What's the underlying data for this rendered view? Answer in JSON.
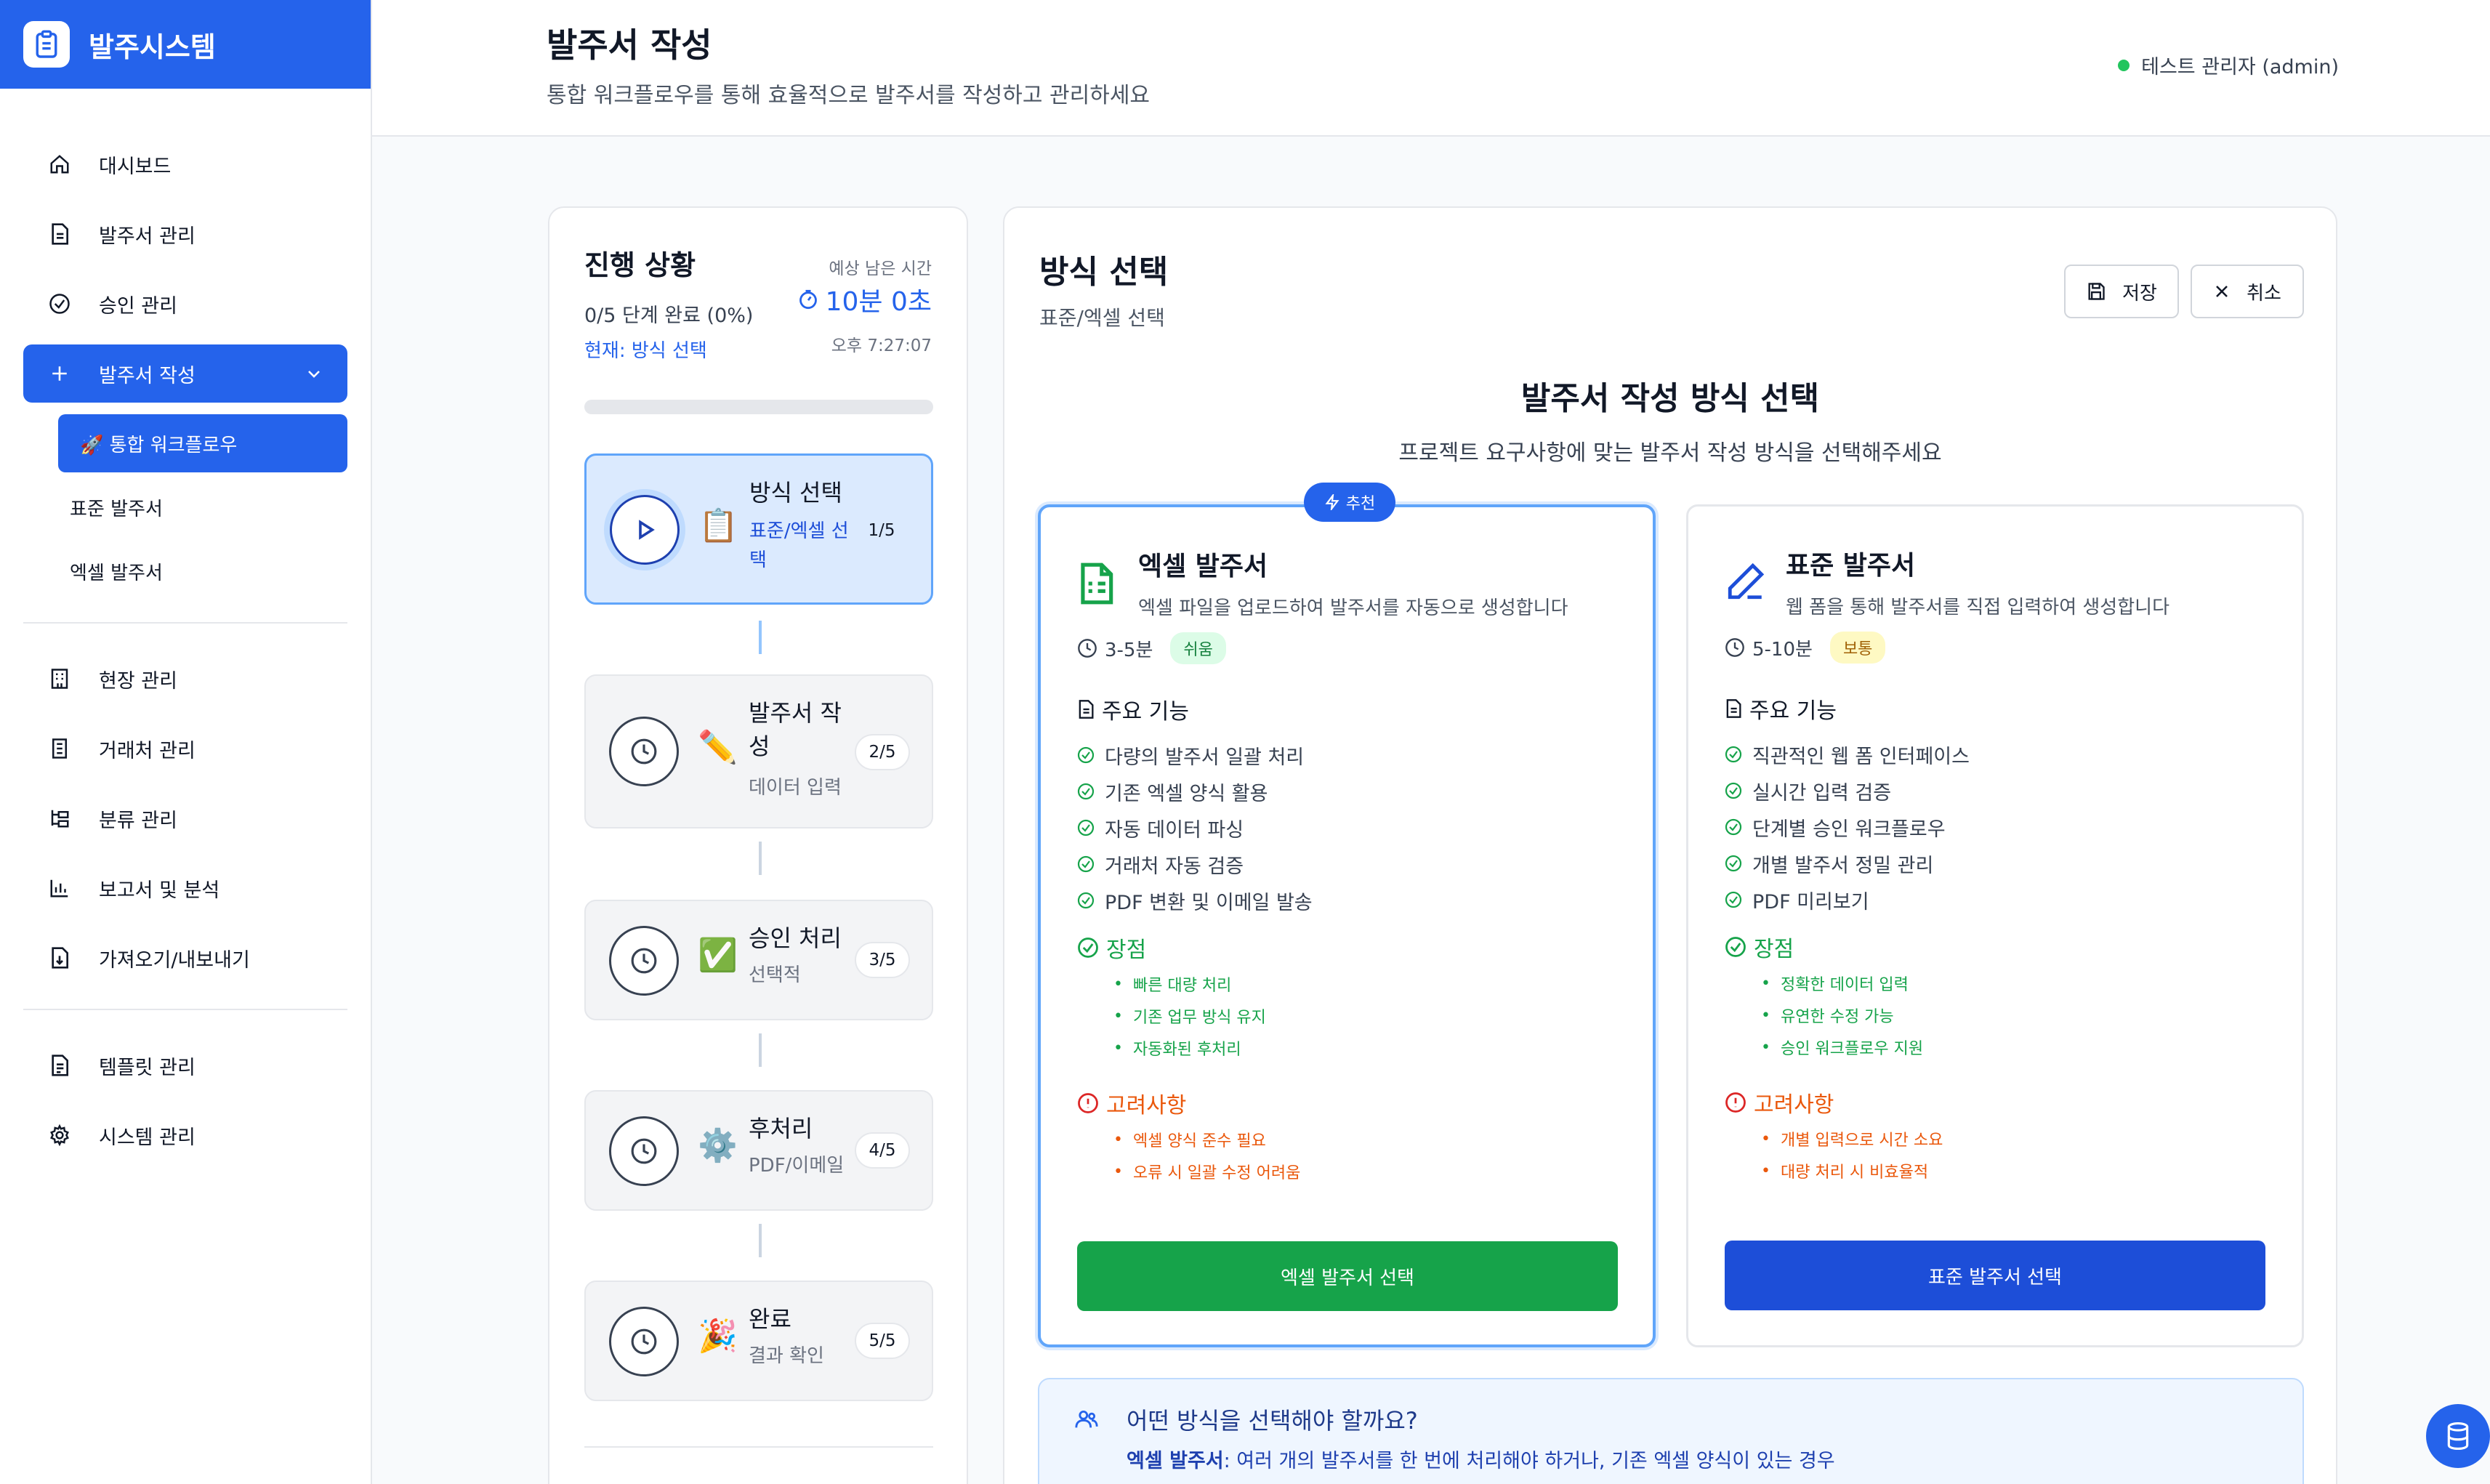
{
  "brand": {
    "name": "발주시스템",
    "icon": "clipboard-icon"
  },
  "sidebar": {
    "items": [
      {
        "label": "대시보드",
        "icon": "home-icon"
      },
      {
        "label": "발주서 관리",
        "icon": "document-icon"
      },
      {
        "label": "승인 관리",
        "icon": "check-circle-icon"
      },
      {
        "label": "발주서 작성",
        "icon": "plus-icon"
      }
    ],
    "sub_items": [
      {
        "label": "🚀 통합 워크플로우"
      },
      {
        "label": "표준 발주서"
      },
      {
        "label": "엑셀 발주서"
      }
    ],
    "items2": [
      {
        "label": "현장 관리",
        "icon": "building-icon"
      },
      {
        "label": "거래처 관리",
        "icon": "office-icon"
      },
      {
        "label": "분류 관리",
        "icon": "tree-icon"
      },
      {
        "label": "보고서 및 분석",
        "icon": "bar-chart-icon"
      },
      {
        "label": "가져오기/내보내기",
        "icon": "file-download-icon"
      }
    ],
    "items3": [
      {
        "label": "템플릿 관리",
        "icon": "file-text-icon"
      },
      {
        "label": "시스템 관리",
        "icon": "gear-icon"
      }
    ]
  },
  "header": {
    "title": "발주서 작성",
    "subtitle": "통합 워크플로우를 통해 효율적으로 발주서를 작성하고 관리하세요",
    "user": "테스트 관리자 (admin)"
  },
  "progress": {
    "title": "진행 상황",
    "count": "0/5 단계 완료 (0%)",
    "current": "현재: 방식 선택",
    "est_label": "예상 남은 시간",
    "est_time": "10분 0초",
    "clock": "오후 7:27:07",
    "percent": 0,
    "steps": [
      {
        "emoji": "📋",
        "title": "방식 선택",
        "sub": "표준/엑셀 선택",
        "badge": "1/5"
      },
      {
        "emoji": "✏️",
        "title": "발주서 작성",
        "sub": "데이터 입력",
        "badge": "2/5"
      },
      {
        "emoji": "✅",
        "title": "승인 처리",
        "sub": "선택적",
        "badge": "3/5"
      },
      {
        "emoji": "⚙️",
        "title": "후처리",
        "sub": "PDF/이메일",
        "badge": "4/5"
      },
      {
        "emoji": "🎉",
        "title": "완료",
        "sub": "결과 확인",
        "badge": "5/5"
      }
    ]
  },
  "main": {
    "title": "방식 선택",
    "subtitle": "표준/엑셀 선택",
    "save_label": "저장",
    "cancel_label": "취소",
    "select_title": "발주서 작성 방식 선택",
    "select_subtitle": "프로젝트 요구사항에 맞는 발주서 작성 방식을 선택해주세요",
    "excel": {
      "badge": "추천",
      "name": "엑셀 발주서",
      "desc": "엑셀 파일을 업로드하여 발주서를 자동으로 생성합니다",
      "time": "3-5분",
      "difficulty": "쉬움",
      "features_title": "주요 기능",
      "features": [
        "다량의 발주서 일괄 처리",
        "기존 엑셀 양식 활용",
        "자동 데이터 파싱",
        "거래처 자동 검증",
        "PDF 변환 및 이메일 발송"
      ],
      "pros_title": "장점",
      "pros": [
        "빠른 대량 처리",
        "기존 업무 방식 유지",
        "자동화된 후처리"
      ],
      "cons_title": "고려사항",
      "cons": [
        "엑셀 양식 준수 필요",
        "오류 시 일괄 수정 어려움"
      ],
      "button": "엑셀 발주서 선택",
      "color": "#16a34a"
    },
    "standard": {
      "name": "표준 발주서",
      "desc": "웹 폼을 통해 발주서를 직접 입력하여 생성합니다",
      "time": "5-10분",
      "difficulty": "보통",
      "features_title": "주요 기능",
      "features": [
        "직관적인 웹 폼 인터페이스",
        "실시간 입력 검증",
        "단계별 승인 워크플로우",
        "개별 발주서 정밀 관리",
        "PDF 미리보기"
      ],
      "pros_title": "장점",
      "pros": [
        "정확한 데이터 입력",
        "유연한 수정 가능",
        "승인 워크플로우 지원"
      ],
      "cons_title": "고려사항",
      "cons": [
        "개별 입력으로 시간 소요",
        "대량 처리 시 비효율적"
      ],
      "button": "표준 발주서 선택",
      "color": "#1d4ed8"
    },
    "help": {
      "title": "어떤 방식을 선택해야 할까요?",
      "line_bold": "엑셀 발주서",
      "line_rest": ": 여러 개의 발주서를 한 번에 처리해야 하거나, 기존 엑셀 양식이 있는 경우"
    }
  },
  "colors": {
    "accent": "#2563eb",
    "success": "#16a34a",
    "warning": "#ea580c"
  }
}
